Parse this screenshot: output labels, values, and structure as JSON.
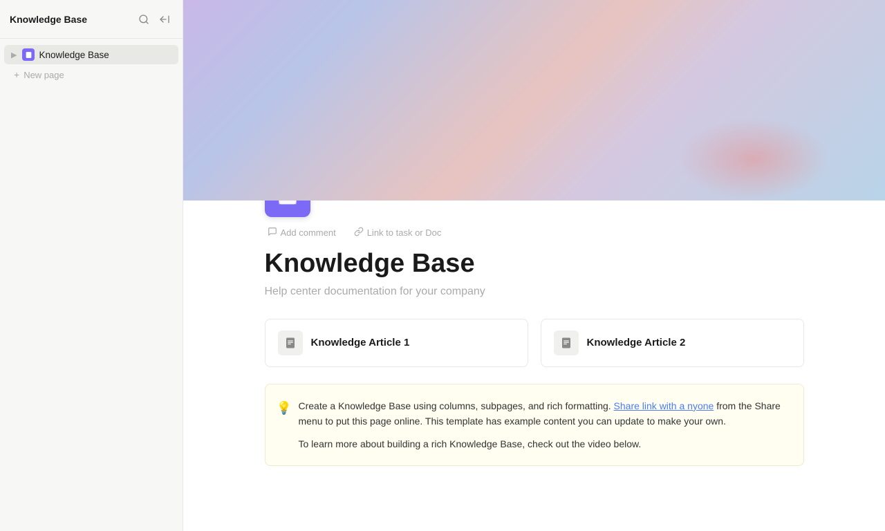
{
  "app": {
    "title": "Knowledge Base"
  },
  "sidebar": {
    "title": "Knowledge Base",
    "items": [
      {
        "id": "knowledge-base",
        "label": "Knowledge Base",
        "active": true
      }
    ],
    "new_page_label": "New page",
    "search_tooltip": "Search",
    "collapse_tooltip": "Collapse sidebar"
  },
  "hero": {
    "alt": "Colorful gradient banner"
  },
  "page": {
    "title": "Knowledge Base",
    "subtitle": "Help center documentation for your company",
    "add_comment_label": "Add comment",
    "link_task_label": "Link to task or Doc"
  },
  "cards": [
    {
      "id": "card1",
      "title": "Knowledge Article 1"
    },
    {
      "id": "card2",
      "title": "Knowledge Article 2"
    }
  ],
  "info_box": {
    "icon": "💡",
    "paragraph1_pre": "Create a Knowledge Base using columns, subpages, and rich formatting. ",
    "link_text": "Share link with a nyone",
    "paragraph1_post": " from the Share menu to put this page online. This template has example content you can update to make your own.",
    "paragraph2": "To learn more about building a rich Knowledge Base, check out the video below."
  }
}
